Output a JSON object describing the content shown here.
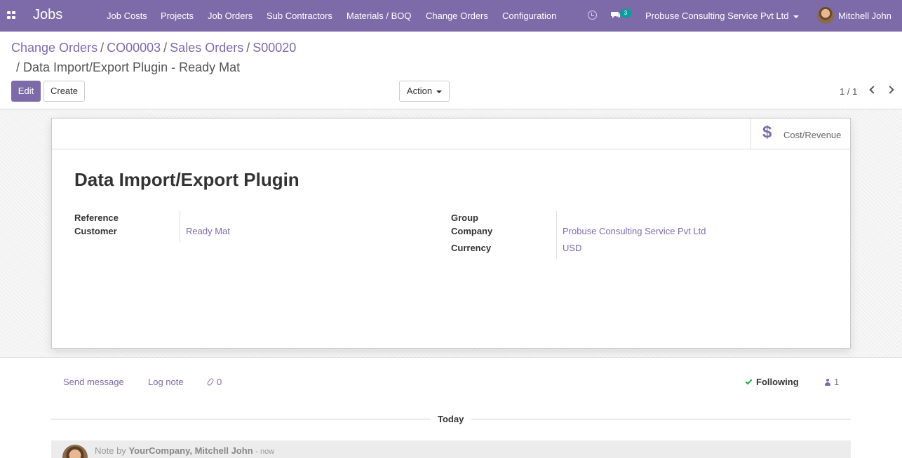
{
  "navbar": {
    "app_name": "Jobs",
    "menu": [
      "Job Costs",
      "Projects",
      "Job Orders",
      "Sub Contractors",
      "Materials / BOQ",
      "Change Orders",
      "Configuration"
    ],
    "chat_count": "3",
    "company": "Probuse Consulting Service Pvt Ltd",
    "user": "Mitchell John",
    "color": "#7c6ba8"
  },
  "breadcrumb": {
    "items": [
      "Change Orders",
      "CO00003",
      "Sales Orders",
      "S00020"
    ],
    "separator": "/",
    "current": "/ Data Import/Export Plugin - Ready Mat"
  },
  "buttons": {
    "edit": "Edit",
    "create": "Create",
    "action": "Action"
  },
  "pager": "1 / 1",
  "form": {
    "stat_button": {
      "icon": "$",
      "label": "Cost/Revenue"
    },
    "title": "Data Import/Export Plugin",
    "left_fields": [
      {
        "label": "Reference",
        "value": ""
      },
      {
        "label": "Customer",
        "value": "Ready Mat"
      }
    ],
    "right_fields": [
      {
        "label": "Group",
        "value": ""
      },
      {
        "label": "Company",
        "value": "Probuse Consulting Service Pvt Ltd"
      },
      {
        "label": "Currency",
        "value": "USD"
      }
    ]
  },
  "chatter": {
    "send_message": "Send message",
    "log_note": "Log note",
    "attachments": "0",
    "following": "Following",
    "followers": "1",
    "date_separator": "Today",
    "message": {
      "prefix": "Note by",
      "author": "YourCompany, Mitchell John",
      "time": "- now"
    }
  }
}
